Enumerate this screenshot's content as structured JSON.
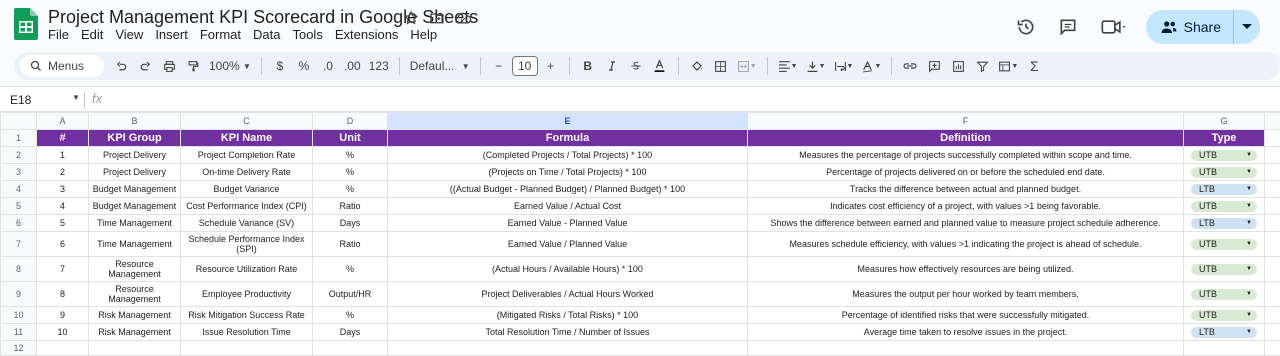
{
  "doc": {
    "title": "Project Management KPI Scorecard in Google Sheets",
    "menus": [
      "File",
      "Edit",
      "View",
      "Insert",
      "Format",
      "Data",
      "Tools",
      "Extensions",
      "Help"
    ],
    "share_label": "Share"
  },
  "toolbar": {
    "search_label": "Menus",
    "zoom": "100%",
    "currency": "$",
    "percent": "%",
    "dec_decrease": ".0",
    "dec_increase": ".00",
    "number_format": "123",
    "font": "Defaul...",
    "font_size": "10",
    "minus": "−",
    "plus": "+",
    "bold": "B",
    "sum": "Σ"
  },
  "formula_bar": {
    "cell_ref": "E18",
    "fx": "fx"
  },
  "colors": {
    "header_bg": "#7030a0",
    "utb_chip": "#d9ead3",
    "ltb_chip": "#cfe2f3",
    "share_bg": "#c2e7ff",
    "selected_col": "#d3e3fd"
  },
  "sheet": {
    "columns": [
      "A",
      "B",
      "C",
      "D",
      "E",
      "F",
      "G"
    ],
    "headers": [
      "#",
      "KPI Group",
      "KPI Name",
      "Unit",
      "Formula",
      "Definition",
      "Type"
    ],
    "rows": [
      {
        "n": "1",
        "group": "Project Delivery",
        "name": "Project Completion Rate",
        "unit": "%",
        "formula": "(Completed Projects / Total Projects) * 100",
        "definition": "Measures the percentage of projects successfully completed within scope and time.",
        "type": "UTB"
      },
      {
        "n": "2",
        "group": "Project Delivery",
        "name": "On-time Delivery Rate",
        "unit": "%",
        "formula": "(Projects on Time / Total Projects) * 100",
        "definition": "Percentage of projects delivered on or before the scheduled end date.",
        "type": "UTB"
      },
      {
        "n": "3",
        "group": "Budget Management",
        "name": "Budget Variance",
        "unit": "%",
        "formula": "((Actual Budget - Planned Budget) / Planned Budget) * 100",
        "definition": "Tracks the difference between actual and planned budget.",
        "type": "LTB"
      },
      {
        "n": "4",
        "group": "Budget Management",
        "name": "Cost Performance Index (CPI)",
        "unit": "Ratio",
        "formula": "Earned Value / Actual Cost",
        "definition": "Indicates cost efficiency of a project, with values >1 being favorable.",
        "type": "UTB"
      },
      {
        "n": "5",
        "group": "Time Management",
        "name": "Schedule Variance (SV)",
        "unit": "Days",
        "formula": "Earned Value - Planned Value",
        "definition": "Shows the difference between earned and planned value to measure project schedule adherence.",
        "type": "LTB"
      },
      {
        "n": "6",
        "group": "Time Management",
        "name": "Schedule Performance Index (SPI)",
        "unit": "Ratio",
        "formula": "Earned Value / Planned Value",
        "definition": "Measures schedule efficiency, with values >1 indicating the project is ahead of schedule.",
        "type": "UTB"
      },
      {
        "n": "7",
        "group": "Resource Management",
        "name": "Resource Utilization Rate",
        "unit": "%",
        "formula": "(Actual Hours / Available Hours) * 100",
        "definition": "Measures how effectively resources are being utilized.",
        "type": "UTB"
      },
      {
        "n": "8",
        "group": "Resource Management",
        "name": "Employee Productivity",
        "unit": "Output/HR",
        "formula": "Project Deliverables / Actual Hours Worked",
        "definition": "Measures the output per hour worked by team members.",
        "type": "UTB"
      },
      {
        "n": "9",
        "group": "Risk Management",
        "name": "Risk Mitigation Success Rate",
        "unit": "%",
        "formula": "(Mitigated Risks / Total Risks) * 100",
        "definition": "Percentage of identified risks that were successfully mitigated.",
        "type": "UTB"
      },
      {
        "n": "10",
        "group": "Risk Management",
        "name": "Issue Resolution Time",
        "unit": "Days",
        "formula": "Total Resolution Time / Number of Issues",
        "definition": "Average time taken to resolve issues in the project.",
        "type": "LTB"
      }
    ],
    "row_numbers": [
      "1",
      "2",
      "3",
      "4",
      "5",
      "6",
      "7",
      "8",
      "9",
      "10",
      "11",
      "12"
    ]
  }
}
